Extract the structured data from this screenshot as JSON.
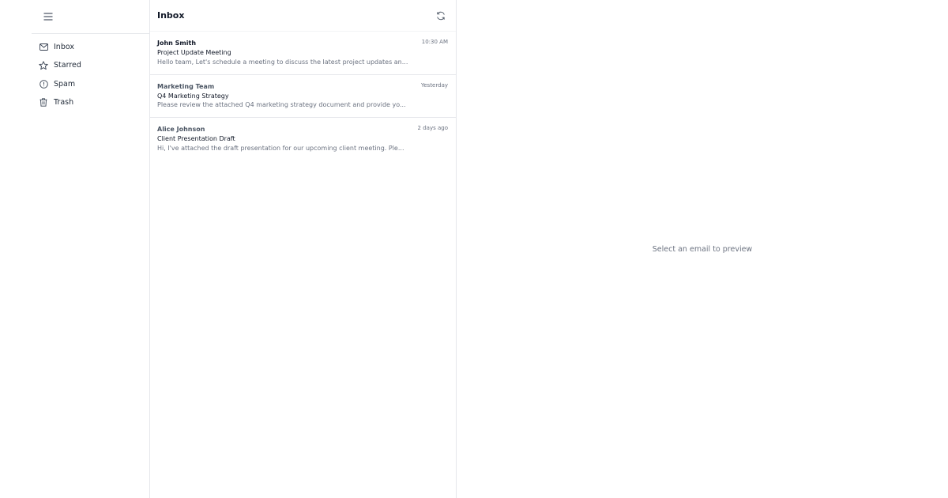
{
  "sidebar": {
    "menu_icon": "hamburger-icon",
    "items": [
      {
        "label": "Inbox",
        "icon": "mail-icon"
      },
      {
        "label": "Starred",
        "icon": "star-icon"
      },
      {
        "label": "Spam",
        "icon": "alert-circle-icon"
      },
      {
        "label": "Trash",
        "icon": "trash-icon"
      }
    ]
  },
  "list": {
    "title": "Inbox",
    "refresh_icon": "refresh-icon",
    "emails": [
      {
        "sender": "John Smith",
        "time": "10:30 AM",
        "subject": "Project Update Meeting",
        "snippet": "Hello team, Let's schedule a meeting to discuss the latest project updates an..."
      },
      {
        "sender": "Marketing Team",
        "time": "Yesterday",
        "subject": "Q4 Marketing Strategy",
        "snippet": "Please review the attached Q4 marketing strategy document and provide yo..."
      },
      {
        "sender": "Alice Johnson",
        "time": "2 days ago",
        "subject": "Client Presentation Draft",
        "snippet": "Hi, I've attached the draft presentation for our upcoming client meeting. Ple..."
      }
    ]
  },
  "preview": {
    "empty_text": "Select an email to preview"
  },
  "colors": {
    "text_primary": "#111827",
    "text_secondary": "#6b7280",
    "border": "#e5e7eb"
  }
}
